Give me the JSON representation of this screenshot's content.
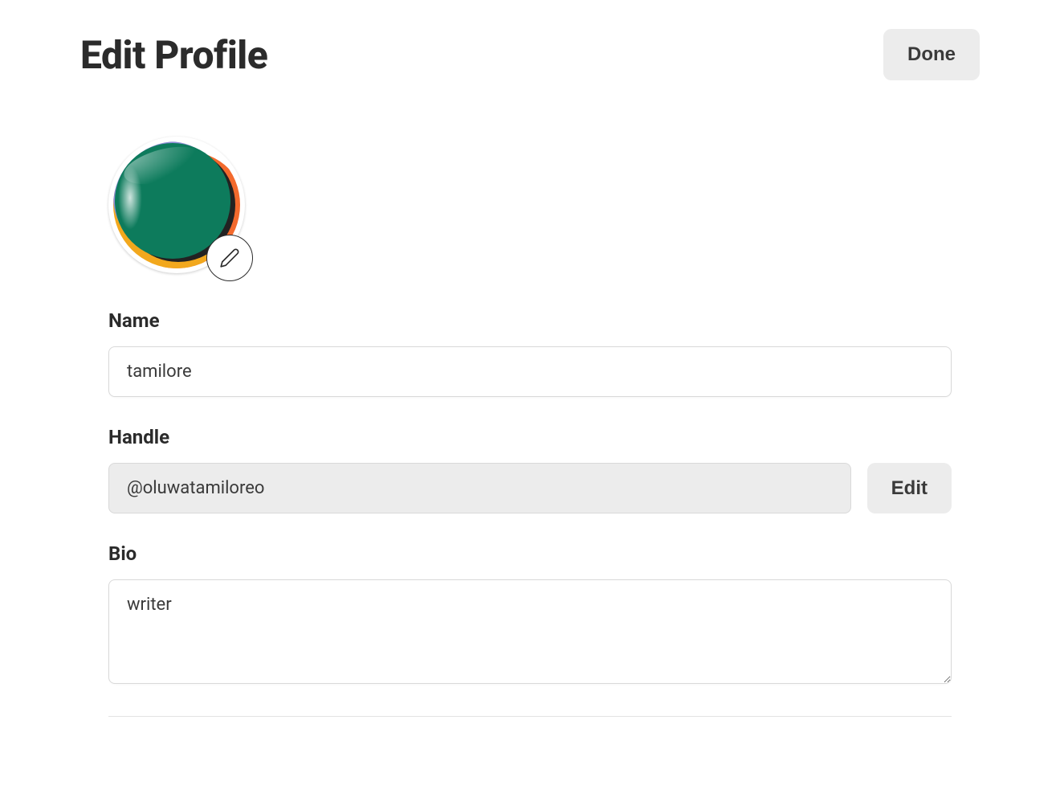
{
  "header": {
    "title": "Edit Profile",
    "done_label": "Done"
  },
  "avatar": {
    "icon": "pencil-icon",
    "palette": {
      "green": "#0d7b5c",
      "orange": "#f36a2d",
      "yellow": "#f2a81d",
      "purple": "#8e8ed6"
    }
  },
  "fields": {
    "name": {
      "label": "Name",
      "value": "tamilore"
    },
    "handle": {
      "label": "Handle",
      "value": "@oluwatamiloreo",
      "edit_label": "Edit"
    },
    "bio": {
      "label": "Bio",
      "value": "writer"
    }
  }
}
